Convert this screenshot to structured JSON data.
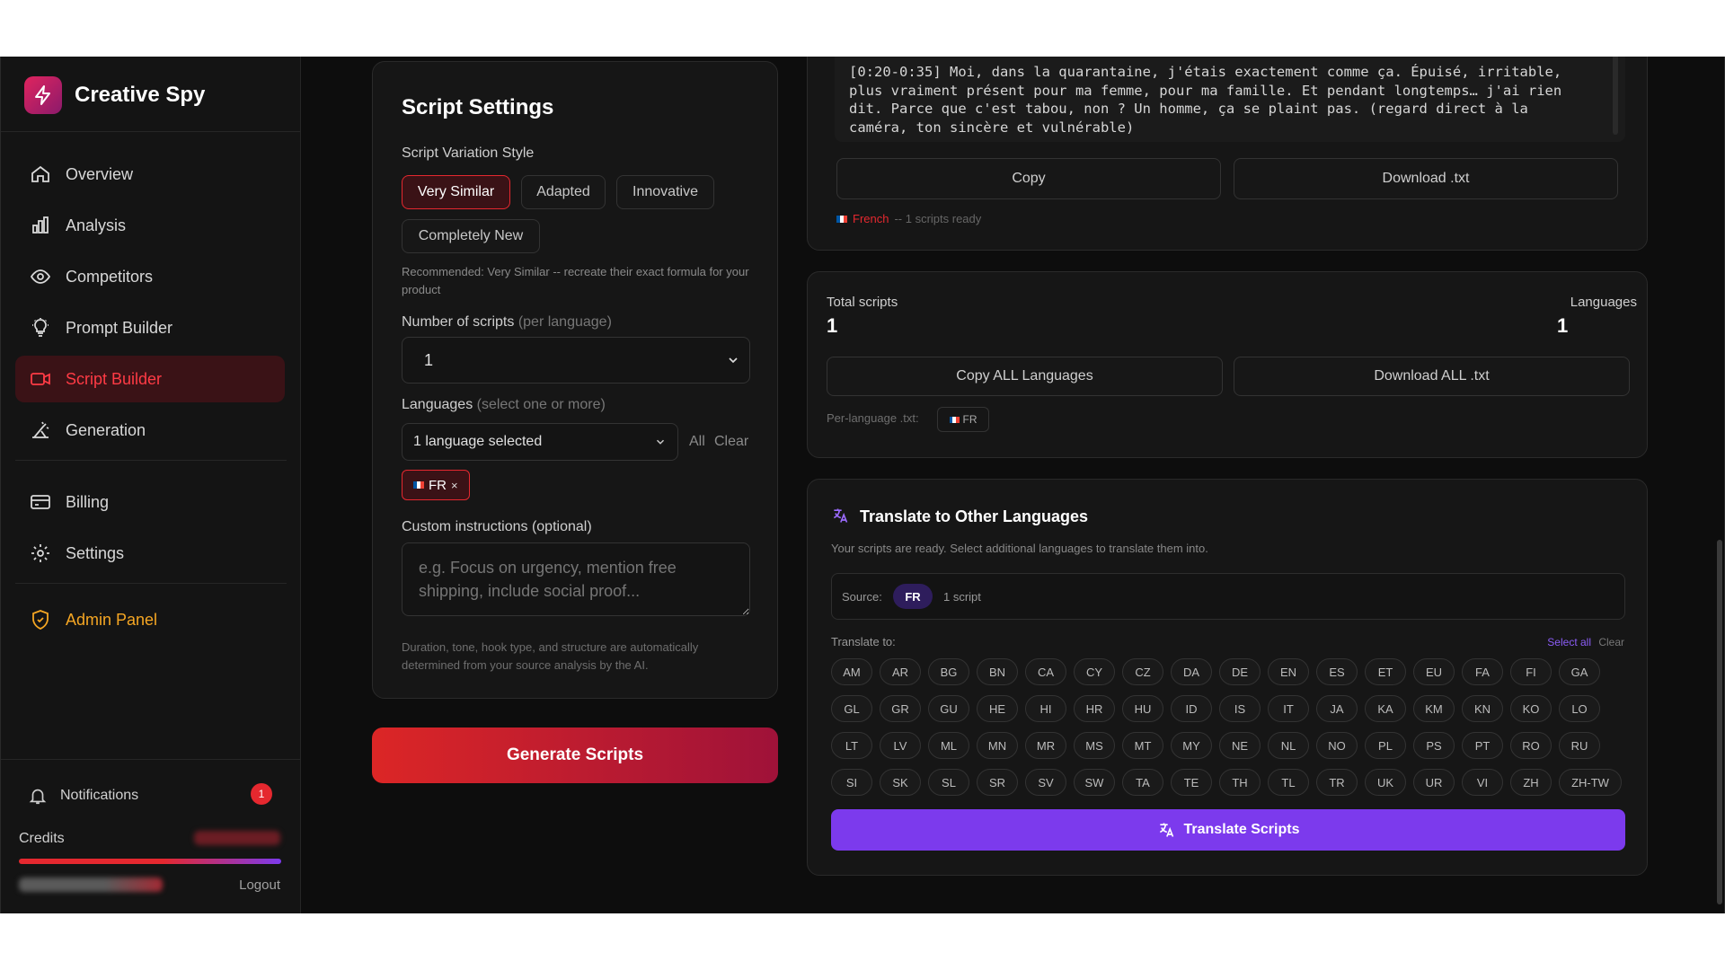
{
  "brand": {
    "name": "Creative Spy"
  },
  "nav": [
    {
      "label": "Overview",
      "icon": "home-icon"
    },
    {
      "label": "Analysis",
      "icon": "bar-chart-icon"
    },
    {
      "label": "Competitors",
      "icon": "eye-icon"
    },
    {
      "label": "Prompt Builder",
      "icon": "lightbulb-icon"
    },
    {
      "label": "Script Builder",
      "icon": "video-icon",
      "active": true
    },
    {
      "label": "Generation",
      "icon": "wand-icon"
    },
    {
      "label": "Billing",
      "icon": "credit-card-icon"
    },
    {
      "label": "Settings",
      "icon": "gear-icon"
    },
    {
      "label": "Admin Panel",
      "icon": "shield-icon"
    }
  ],
  "sidebar_footer": {
    "notifications_label": "Notifications",
    "notifications_count": "1",
    "credits_label": "Credits",
    "logout_label": "Logout"
  },
  "settings": {
    "title": "Script Settings",
    "variation_label": "Script Variation Style",
    "variation_options": [
      "Very Similar",
      "Adapted",
      "Innovative",
      "Completely New"
    ],
    "variation_selected": "Very Similar",
    "recommendation": "Recommended: Very Similar -- recreate their exact formula for your product",
    "num_scripts_label": "Number of scripts",
    "num_scripts_hint": "(per language)",
    "num_scripts_value": "1",
    "languages_label": "Languages",
    "languages_hint": "(select one or more)",
    "languages_value": "1 language selected",
    "languages_all": "All",
    "languages_clear": "Clear",
    "selected_language_chip": "FR",
    "custom_label": "Custom instructions (optional)",
    "custom_placeholder": "e.g. Focus on urgency, mention free shipping, include social proof...",
    "footnote": "Duration, tone, hook type, and structure are automatically determined from your source analysis by the AI.",
    "generate_label": "Generate Scripts"
  },
  "script_output": {
    "text": "[0:20-0:35] Moi, dans la quarantaine, j'étais exactement comme ça. Épuisé, irritable, plus vraiment présent pour ma femme, pour ma famille. Et pendant longtemps… j'ai rien dit. Parce que c'est tabou, non ? Un homme, ça se plaint pas. (regard direct à la caméra, ton sincère et vulnérable)",
    "copy_label": "Copy",
    "download_label": "Download .txt",
    "language_name": "French",
    "status": "-- 1 scripts ready"
  },
  "summary": {
    "total_label": "Total scripts",
    "total_value": "1",
    "languages_label": "Languages",
    "languages_value": "1",
    "copy_all_label": "Copy ALL Languages",
    "download_all_label": "Download ALL .txt",
    "per_language_label": "Per-language .txt:",
    "per_language_chip": "FR"
  },
  "translate": {
    "title": "Translate to Other Languages",
    "subtitle": "Your scripts are ready. Select additional languages to translate them into.",
    "source_label": "Source:",
    "source_lang": "FR",
    "source_count": "1 script",
    "translate_to_label": "Translate to:",
    "select_all": "Select all",
    "clear": "Clear",
    "languages": [
      "AM",
      "AR",
      "BG",
      "BN",
      "CA",
      "CY",
      "CZ",
      "DA",
      "DE",
      "EN",
      "ES",
      "ET",
      "EU",
      "FA",
      "FI",
      "GA",
      "GL",
      "GR",
      "GU",
      "HE",
      "HI",
      "HR",
      "HU",
      "ID",
      "IS",
      "IT",
      "JA",
      "KA",
      "KM",
      "KN",
      "KO",
      "LO",
      "LT",
      "LV",
      "ML",
      "MN",
      "MR",
      "MS",
      "MT",
      "MY",
      "NE",
      "NL",
      "NO",
      "PL",
      "PS",
      "PT",
      "RO",
      "RU",
      "SI",
      "SK",
      "SL",
      "SR",
      "SV",
      "SW",
      "TA",
      "TE",
      "TH",
      "TL",
      "TR",
      "UK",
      "UR",
      "VI",
      "ZH",
      "ZH-TW"
    ],
    "button_label": "Translate Scripts"
  },
  "colors": {
    "accent_red": "#e5282f",
    "accent_purple": "#7c3aed",
    "admin_orange": "#f5a623"
  }
}
